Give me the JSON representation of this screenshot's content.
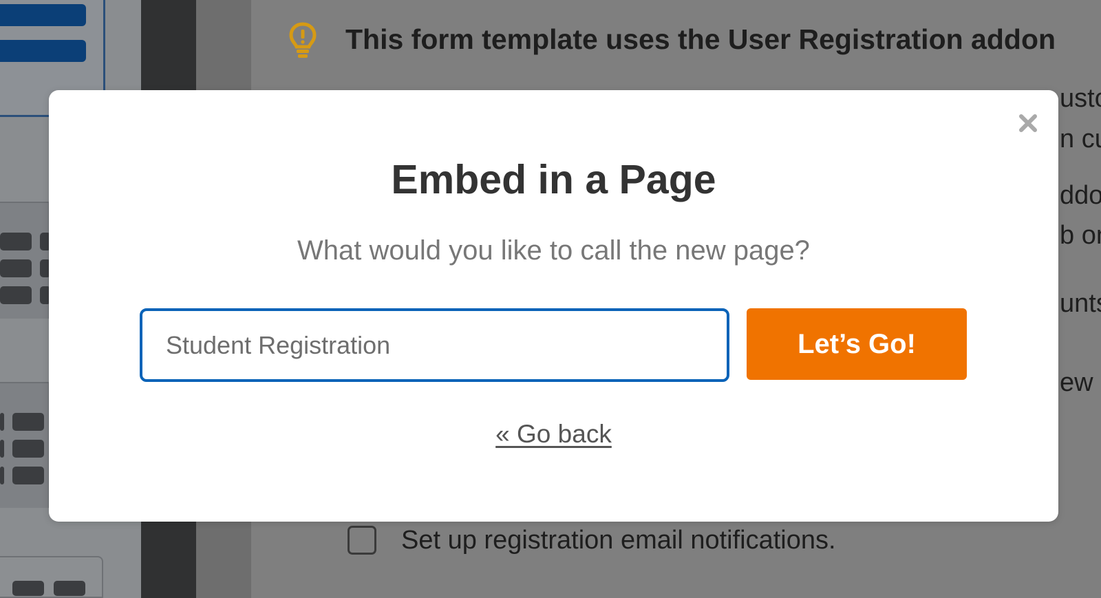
{
  "background": {
    "headline": "This form template uses the User Registration addon",
    "right_fragments": [
      "usto",
      "n cu",
      "ddon",
      "b on",
      "unts",
      "ew"
    ],
    "checklist_item": "Set up registration email notifications.",
    "icons": {
      "bulb": "lightbulb-icon"
    }
  },
  "modal": {
    "title": "Embed in a Page",
    "question": "What would you like to call the new page?",
    "input": {
      "value": "",
      "placeholder": "Student Registration"
    },
    "submit_label": "Let’s Go!",
    "back_label": "« Go back",
    "close_icon": "close-icon"
  },
  "colors": {
    "accent": "#f07300",
    "input_border": "#0a63b8",
    "overlay": "#808080",
    "bulb": "#d69a14"
  }
}
